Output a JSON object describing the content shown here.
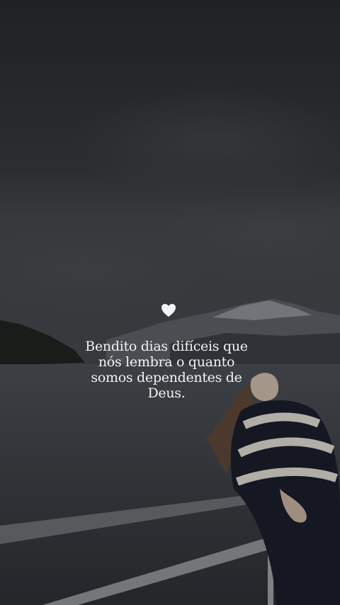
{
  "quote": {
    "lines": [
      "Bendito dias difíceis que",
      "nós lembra o quanto",
      "somos dependentes de",
      "Deus."
    ]
  },
  "heart_icon": "heart-icon",
  "colors": {
    "sky_top": "#2a2c2f",
    "sky_mid": "#3c3f43",
    "water": "#35393d",
    "text": "#f2f2f2",
    "heart": "#f4f4f4"
  }
}
